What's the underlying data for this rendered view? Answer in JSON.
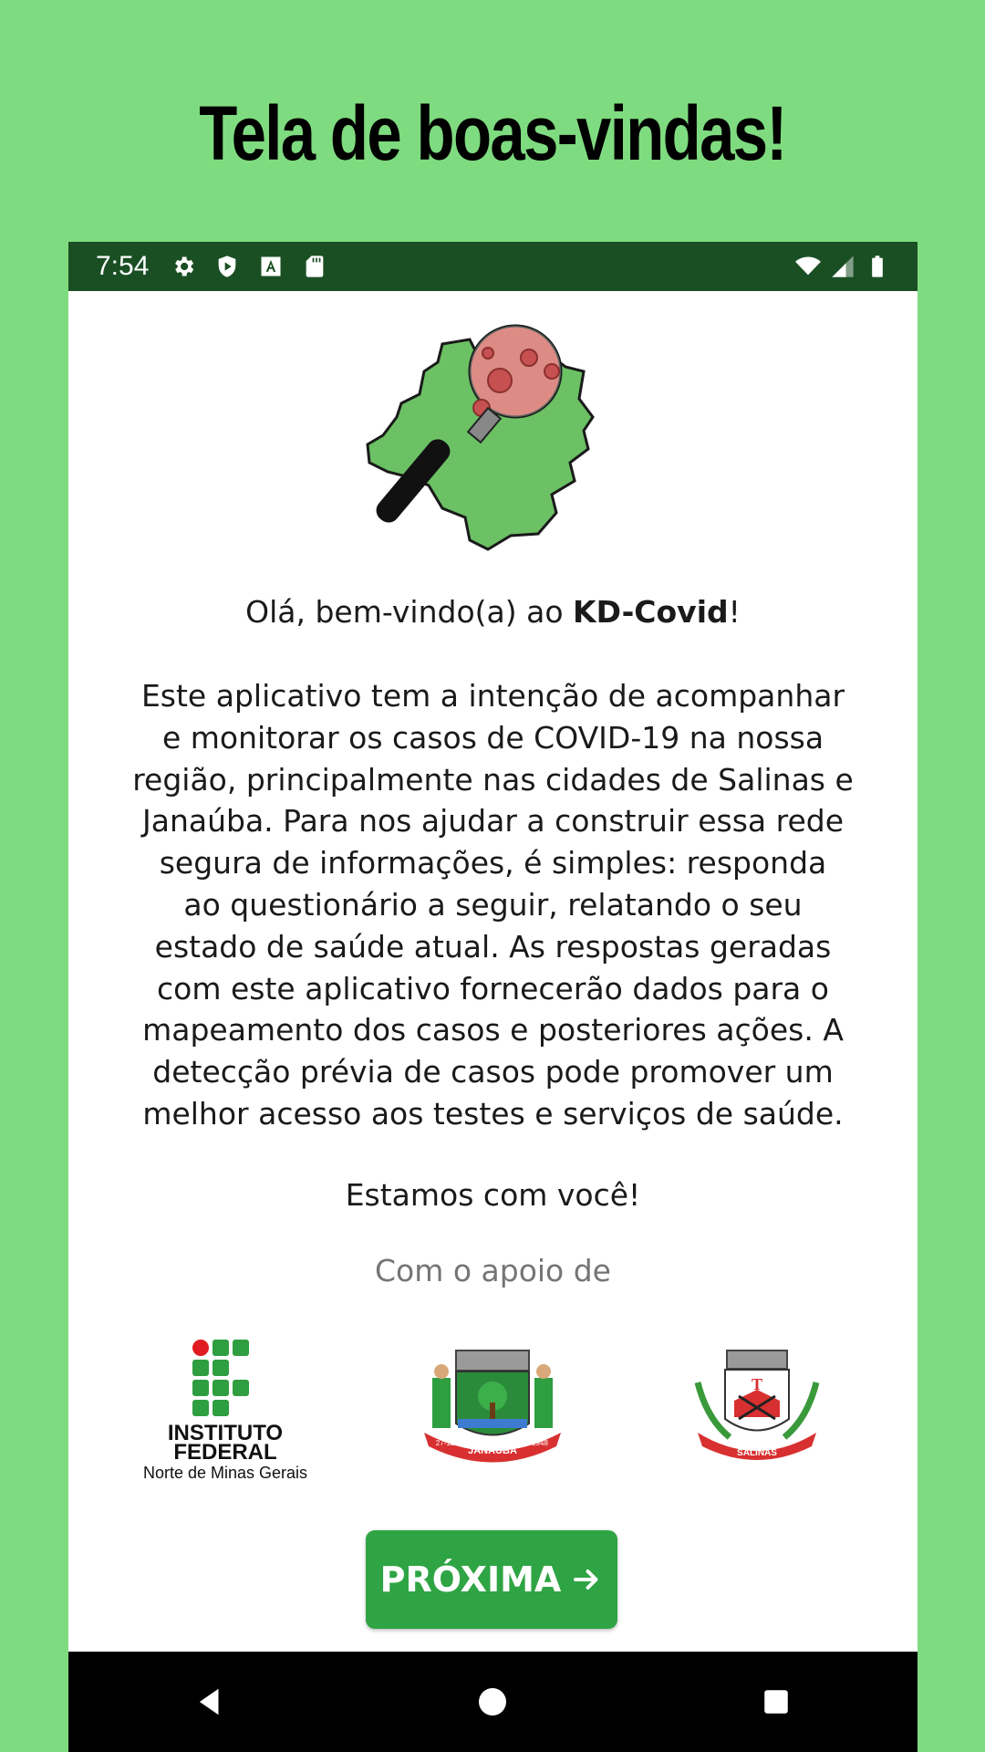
{
  "page_title": "Tela de boas-vindas!",
  "status_bar": {
    "time": "7:54",
    "left_icons": [
      "gear-icon",
      "shield-icon",
      "text-a-icon",
      "sd-card-icon"
    ],
    "right_icons": [
      "wifi-icon",
      "signal-icon",
      "battery-icon"
    ],
    "background": "#1a4f24"
  },
  "welcome": {
    "greeting_prefix": "Olá, bem-vindo(a) ao ",
    "app_name": "KD-Covid",
    "greeting_suffix": "!",
    "description_lines": [
      "Este aplicativo tem a intenção de acompanhar",
      "e monitorar os casos de COVID-19 na nossa",
      "região, principalmente nas cidades de Salinas e",
      "Janaúba. Para nos ajudar a construir essa rede",
      "segura de informações, é simples: responda",
      "ao questionário a seguir, relatando o seu",
      "estado de saúde atual. As respostas geradas",
      "com este aplicativo fornecerão dados para o",
      "mapeamento dos casos e posteriores ações. A",
      "detecção prévia de casos pode promover um",
      "melhor acesso aos testes e serviços de saúde."
    ],
    "closing": "Estamos com você!",
    "support_label": "Com o apoio de"
  },
  "partners": {
    "instituto_line1": "INSTITUTO",
    "instituto_line2": "FEDERAL",
    "instituto_line3": "Norte de Minas Gerais",
    "janauba_banner": "JANAÚBA",
    "janauba_left": "27-12",
    "janauba_right": "1948",
    "salinas_banner": "SALINAS"
  },
  "next_button": {
    "label": "PRÓXIMA",
    "icon": "arrow-right-icon",
    "color": "#2fa444"
  },
  "navigation": [
    "back-icon",
    "home-icon",
    "recents-icon"
  ],
  "colors": {
    "background": "#7fdb80",
    "brand_green": "#2fa444"
  }
}
